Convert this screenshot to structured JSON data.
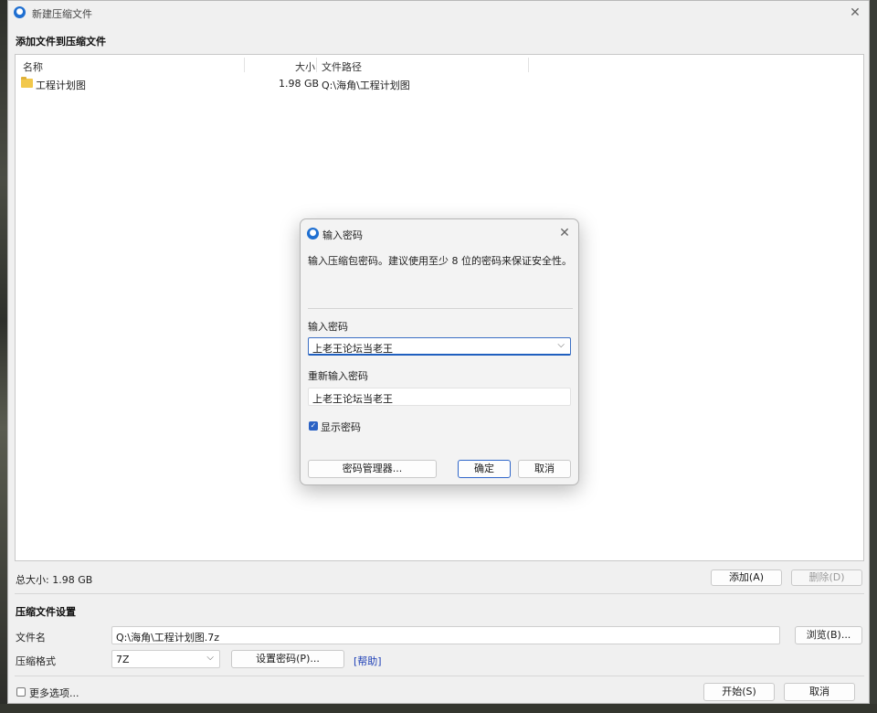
{
  "main_window": {
    "title": "新建压缩文件",
    "heading": "添加文件到压缩文件",
    "columns": {
      "name": "名称",
      "size": "大小",
      "path": "文件路径"
    },
    "rows": [
      {
        "name": "工程计划图",
        "size": "1.98 GB",
        "path": "Q:\\海角\\工程计划图"
      }
    ],
    "total_size": "总大小: 1.98 GB",
    "add_button": "添加(A)",
    "delete_button": "删除(D)",
    "settings_heading": "压缩文件设置",
    "filename_label": "文件名",
    "filename_value": "Q:\\海角\\工程计划图.7z",
    "browse_button": "浏览(B)...",
    "format_label": "压缩格式",
    "format_value": "7Z",
    "set_password_button": "设置密码(P)...",
    "help_link": "[帮助]",
    "more_options_label": "更多选项...",
    "start_button": "开始(S)",
    "cancel_button": "取消"
  },
  "password_dialog": {
    "title": "输入密码",
    "description": "输入压缩包密码。建议使用至少 8 位的密码来保证安全性。",
    "password_label": "输入密码",
    "password_value": "上老王论坛当老王",
    "confirm_label": "重新输入密码",
    "confirm_value": "上老王论坛当老王",
    "show_password_label": "显示密码",
    "show_password_checked": true,
    "manager_button": "密码管理器...",
    "ok_button": "确定",
    "cancel_button": "取消"
  },
  "colors": {
    "accent": "#2b62c4",
    "link": "#1d3fb6",
    "folder": "#f2c84b"
  }
}
